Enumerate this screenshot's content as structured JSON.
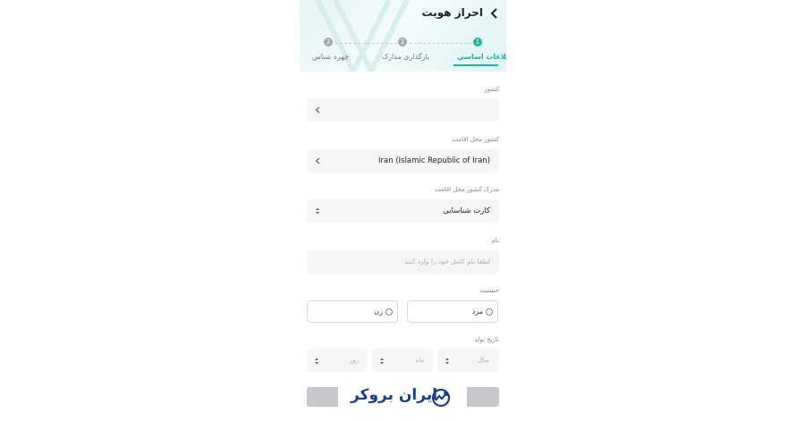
{
  "header": {
    "title": "احراز هویت"
  },
  "stepper": {
    "steps": [
      {
        "number": "1",
        "label": "اطلاعات اساسی",
        "active": true
      },
      {
        "number": "2",
        "label": "بارگذاری مدارک",
        "active": false
      },
      {
        "number": "3",
        "label": "چهره شناس",
        "active": false
      }
    ]
  },
  "form": {
    "country": {
      "label": "کشور",
      "value": ""
    },
    "residence_country": {
      "label": "کشور محل اقامت",
      "value": "Iran (Islamic Republic of Iran)"
    },
    "residence_document": {
      "label": "مدرک کشور محل اقامت",
      "value": "کارت شناسایی"
    },
    "name": {
      "label": "نام",
      "placeholder": "لطفا نام کامل خود را وارد کنید"
    },
    "gender": {
      "label": "جنسیت",
      "options": [
        "مرد",
        "زن"
      ]
    },
    "birth_date": {
      "label": "تاریخ تولد",
      "year": "سال",
      "month": "ماه",
      "day": "روز"
    }
  },
  "watermark": {
    "text": "ایران بروکر"
  },
  "colors": {
    "accent": "#1fb5a5",
    "brand": "#1c3f8c"
  }
}
